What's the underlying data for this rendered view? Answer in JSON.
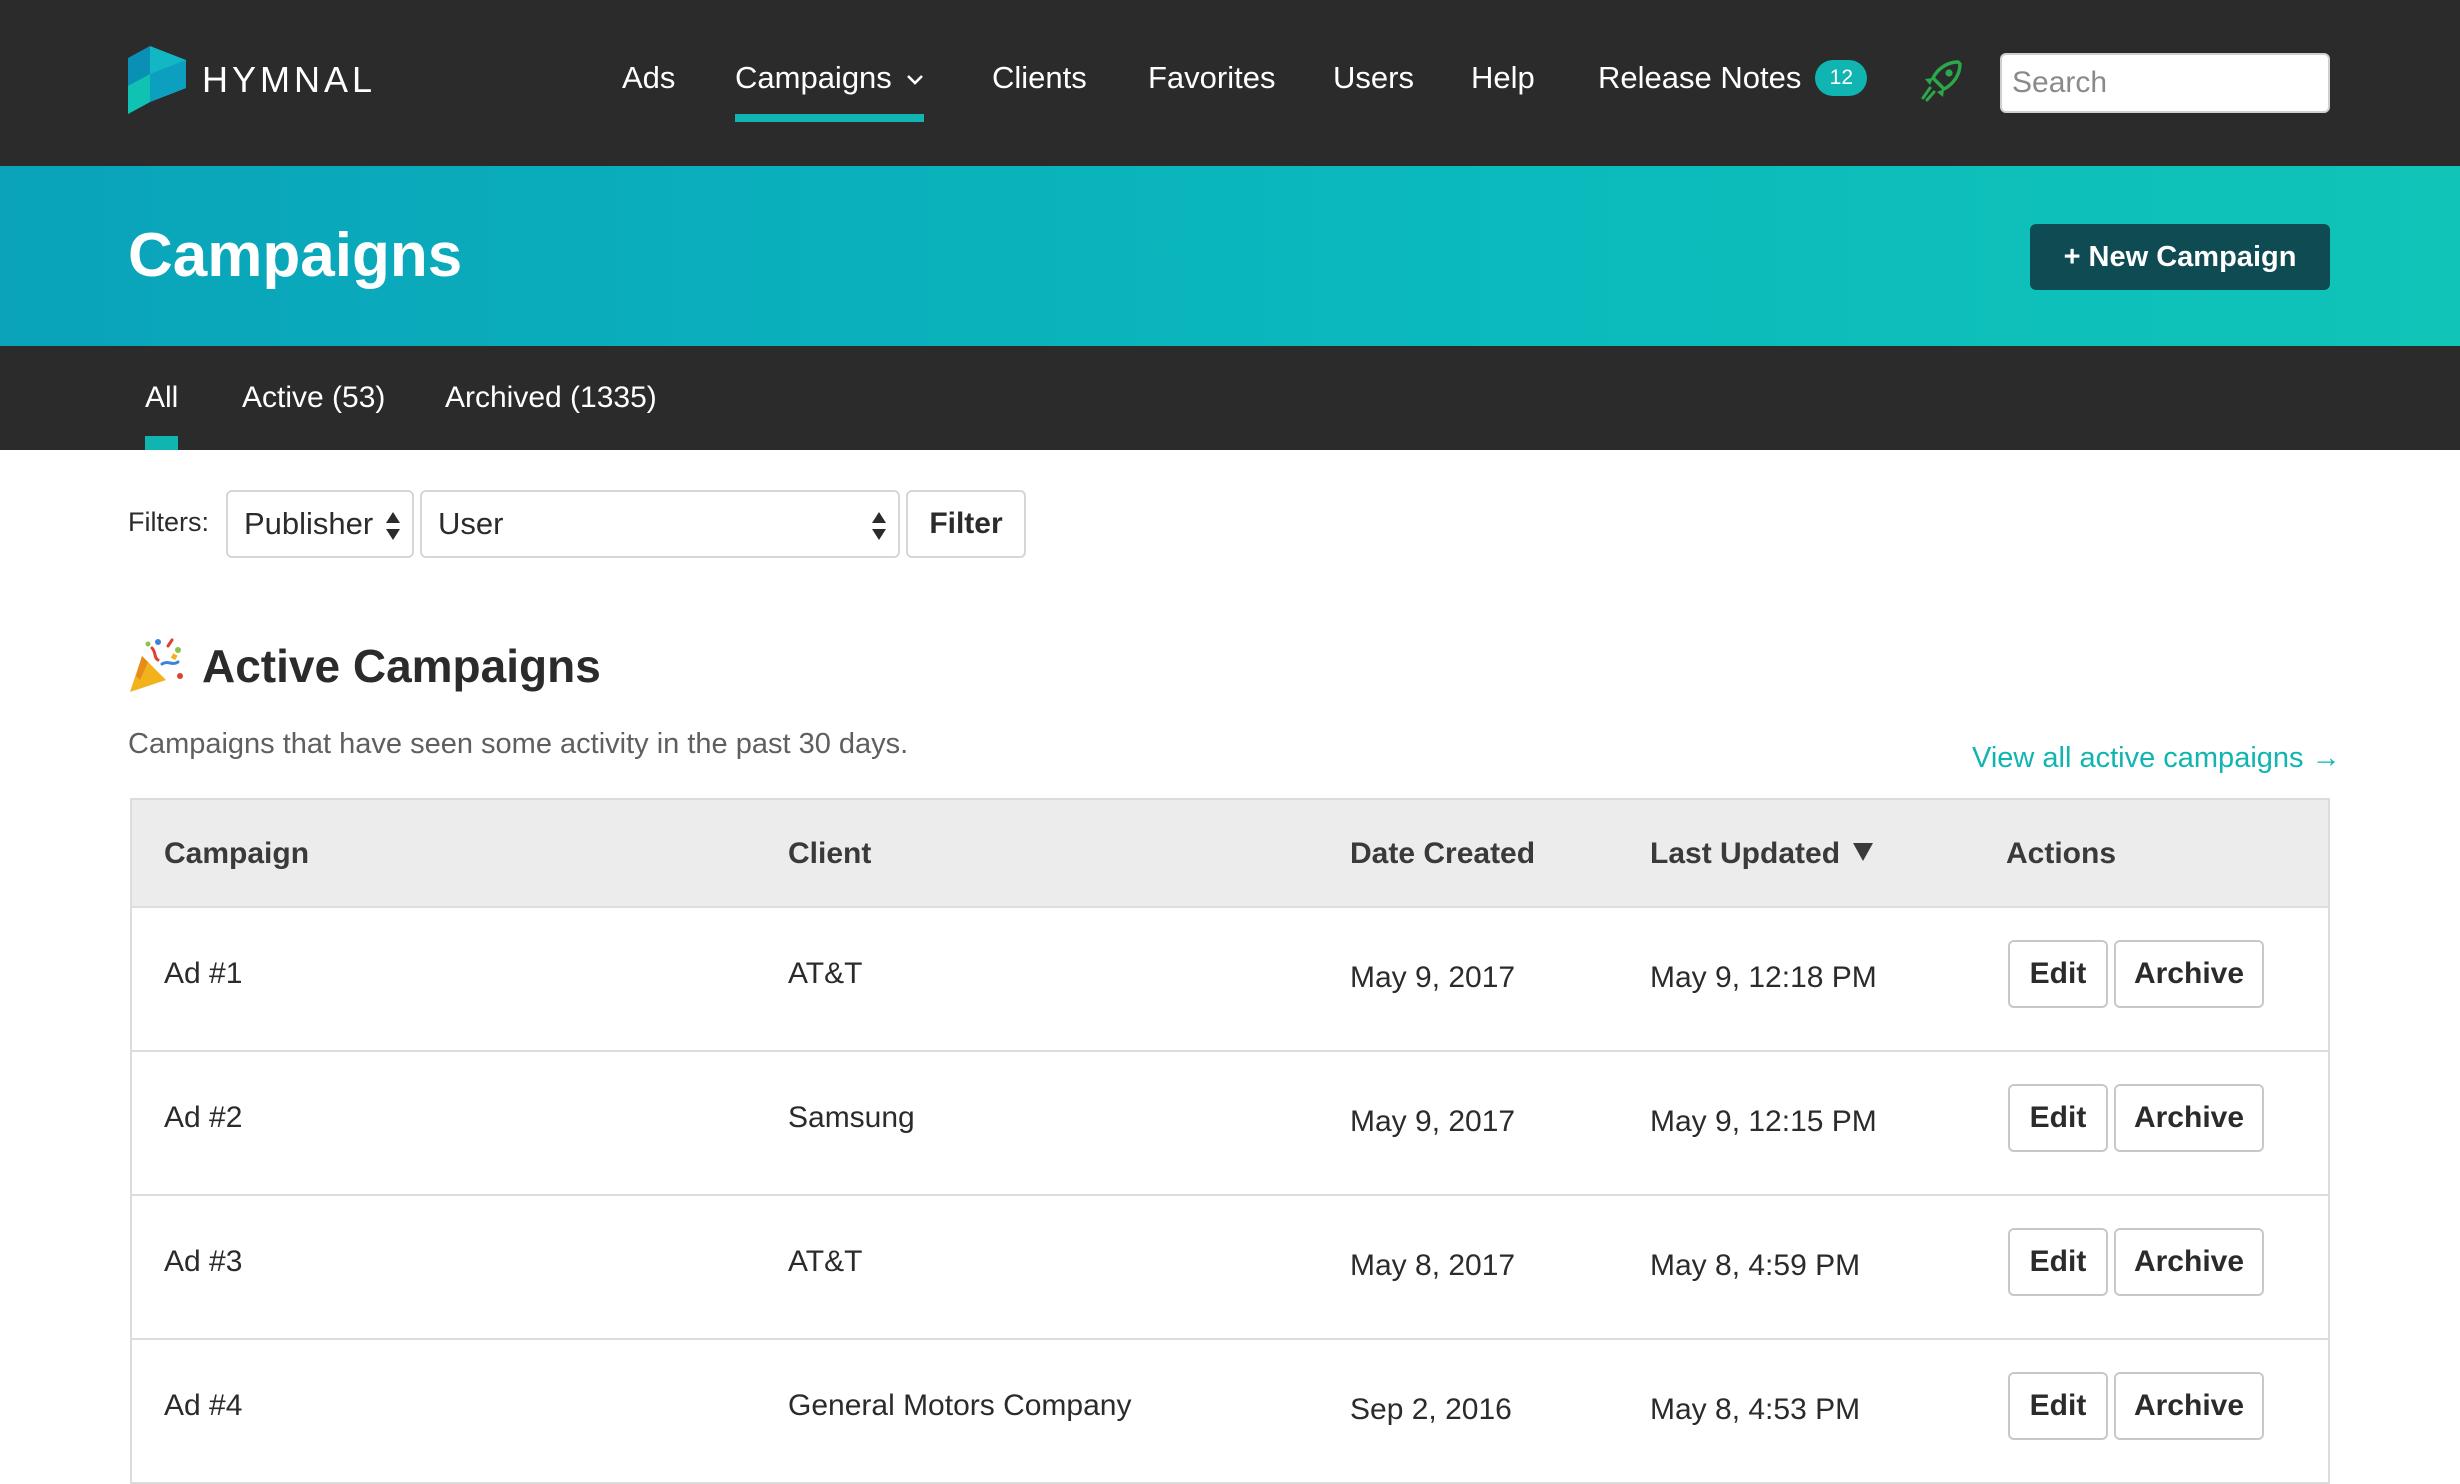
{
  "app": {
    "name": "HYMNAL"
  },
  "nav": {
    "ads": "Ads",
    "campaigns": "Campaigns",
    "clients": "Clients",
    "favorites": "Favorites",
    "users": "Users",
    "help": "Help",
    "release_notes": "Release Notes",
    "release_notes_count": "12",
    "search_placeholder": "Search"
  },
  "header": {
    "title": "Campaigns",
    "new_button": "+ New Campaign"
  },
  "subtabs": {
    "all": "All",
    "active": "Active (53)",
    "archived": "Archived (1335)",
    "selected": "All"
  },
  "filters": {
    "label": "Filters:",
    "publisher": "Publisher",
    "user": "User",
    "button": "Filter"
  },
  "section": {
    "icon": "party-popper-icon",
    "title": "Active Campaigns",
    "description": "Campaigns that have seen some activity in the past 30 days.",
    "view_all": "View all active campaigns →"
  },
  "table": {
    "headers": [
      "Campaign",
      "Client",
      "Date Created",
      "Last Updated",
      "Actions"
    ],
    "sort_column": "Last Updated",
    "sort_direction": "descending",
    "edit_label": "Edit",
    "archive_label": "Archive",
    "rows": [
      {
        "campaign": "Ad #1",
        "client": "AT&T",
        "created": "May 9, 2017",
        "updated": "May 9, 12:18 PM"
      },
      {
        "campaign": "Ad #2",
        "client": "Samsung",
        "created": "May 9, 2017",
        "updated": "May 9, 12:15 PM"
      },
      {
        "campaign": "Ad #3",
        "client": "AT&T",
        "created": "May 8, 2017",
        "updated": "May 8, 4:59 PM"
      },
      {
        "campaign": "Ad #4",
        "client": "General Motors Company",
        "created": "Sep 2, 2016",
        "updated": "May 8, 4:53 PM"
      }
    ]
  },
  "colors": {
    "nav_bg": "#2b2b2b",
    "accent": "#10b5b1",
    "banner_start": "#0aa3ba",
    "banner_end": "#10c4b8",
    "new_button_bg": "#0e4b52",
    "rocket": "#2ba84a"
  }
}
